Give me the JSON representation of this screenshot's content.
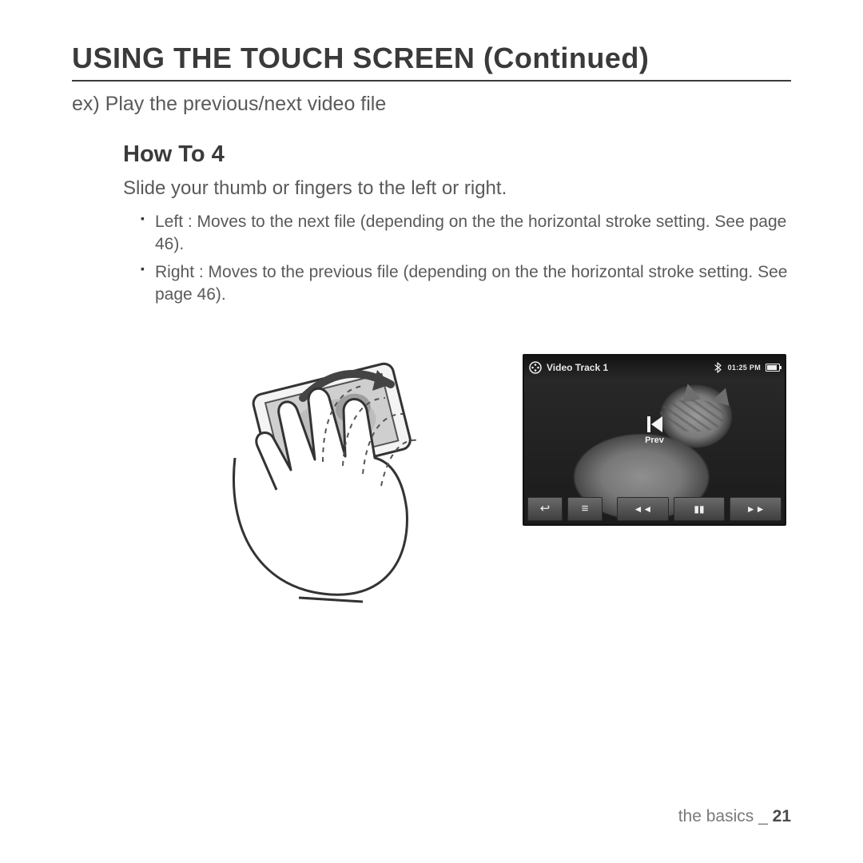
{
  "title": "USING THE TOUCH SCREEN (Continued)",
  "example_line": "ex) Play the previous/next video file",
  "howto": {
    "heading": "How To 4",
    "subtitle": "Slide your thumb or fingers to the left or right.",
    "bullets": [
      "Left : Moves to the next file (depending on the the horizontal stroke setting. See page 46).",
      "Right : Moves to the previous file (depending on the the horizontal stroke setting. See page 46)."
    ]
  },
  "device": {
    "track_title": "Video Track 1",
    "time": "01:25 PM",
    "overlay_label": "Prev",
    "icons": {
      "film": "film-reel-icon",
      "bluetooth": "bluetooth-icon",
      "battery": "battery-icon",
      "prev_overlay": "skip-prev-icon"
    },
    "toolbar": {
      "back": "↩",
      "menu": "≡",
      "prev": "◄◄",
      "pause": "▮▮",
      "next": "►►"
    }
  },
  "footer": {
    "section": "the basics _",
    "page": "21"
  }
}
